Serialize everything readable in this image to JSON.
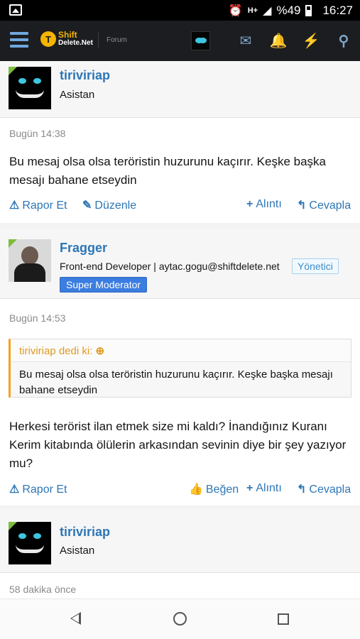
{
  "status_bar": {
    "network": "H+",
    "battery": "%49",
    "time": "16:27"
  },
  "header": {
    "logo_line1": "Shift",
    "logo_line2": "Delete.Net",
    "logo_mark": "T",
    "forum_label": "Forum",
    "icons": [
      "envelope-icon",
      "bell-icon",
      "bolt-icon",
      "search-icon"
    ]
  },
  "posts": [
    {
      "username": "tiriviriap",
      "user_title": "Asistan",
      "date": "Bugün 14:38",
      "message": "Bu mesaj olsa olsa teröristin huzurunu kaçırır. Keşke başka mesajı bahane etseydin",
      "actions": {
        "report": "Rapor Et",
        "edit": "Düzenle",
        "quote": "Alıntı",
        "reply": "Cevapla"
      }
    },
    {
      "username": "Fragger",
      "user_title": "Front-end Developer | aytac.gogu@shiftdelete.net",
      "staff_badge": "Yönetici",
      "user_banner": "Super Moderator",
      "date": "Bugün 14:53",
      "quote": {
        "author": "tiriviriap dedi ki:",
        "text": "Bu mesaj olsa olsa teröristin huzurunu kaçırır. Keşke başka mesajı bahane etseydin"
      },
      "message": "Herkesi terörist ilan etmek size mi kaldı? İnandığınız Kuranı Kerim kitabında ölülerin arkasından sevinin diye bir şey yazıyor mu?",
      "actions": {
        "report": "Rapor Et",
        "like": "Beğen",
        "quote": "Alıntı",
        "reply": "Cevapla"
      }
    },
    {
      "username": "tiriviriap",
      "user_title": "Asistan",
      "date": "58 dakika önce"
    }
  ],
  "colors": {
    "link": "#2d76b5",
    "header_bg": "#1c1d21",
    "brand": "#f4b400",
    "quote_accent": "#f3a21c",
    "banner": "#3b7de0"
  }
}
